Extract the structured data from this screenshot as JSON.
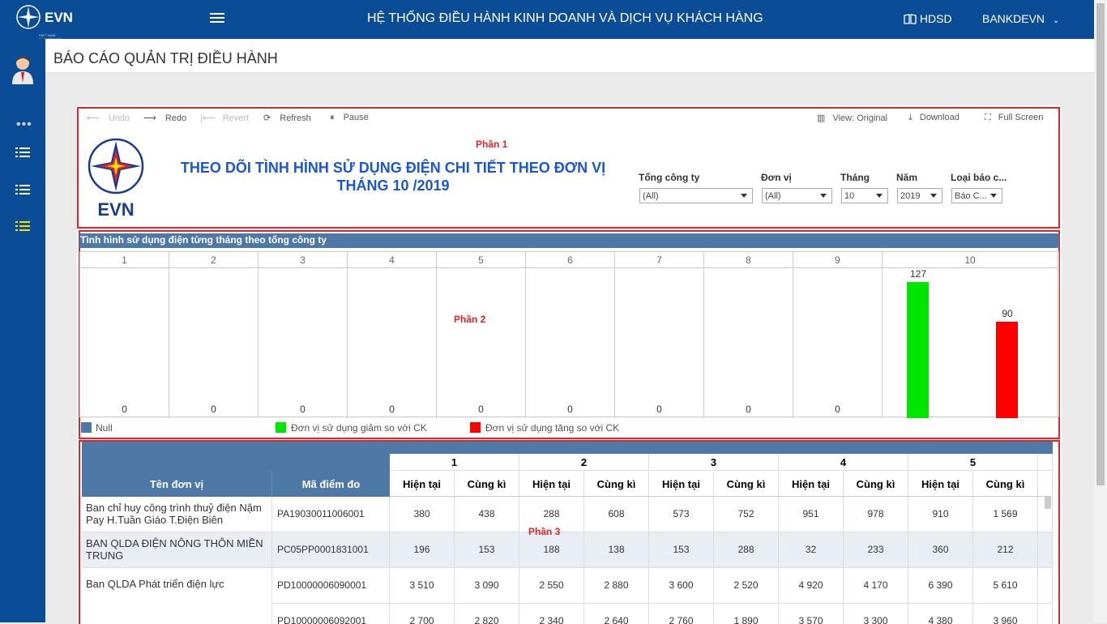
{
  "topbar": {
    "logo_text": "EVN",
    "logo_sub": "VIET NAM ELECTRICITY",
    "app_title": "HỆ THỐNG ĐIỀU HÀNH KINH DOANH VÀ DỊCH VỤ KHÁCH HÀNG",
    "help_label": "HDSD",
    "user_name": "BANKDEVN"
  },
  "page": {
    "title": "BÁO CÁO QUẢN TRỊ ĐIỀU HÀNH"
  },
  "toolbar": {
    "undo": "Undo",
    "redo": "Redo",
    "revert": "Revert",
    "refresh": "Refresh",
    "pause": "Pause",
    "view": "View: Original",
    "download": "Download",
    "fullscreen": "Full Screen"
  },
  "dashboard": {
    "logo_text": "EVN",
    "title_line1": "THEO DÕI TÌNH HÌNH SỬ DỤNG ĐIỆN CHI TIẾT THEO ĐƠN VỊ",
    "title_line2": "THÁNG 10 /2019",
    "part1": "Phần 1",
    "part2": "Phần 2",
    "part3": "Phần 3"
  },
  "filters": {
    "company": {
      "label": "Tổng công ty",
      "value": "(All)"
    },
    "unit": {
      "label": "Đơn vị",
      "value": "(All)"
    },
    "month": {
      "label": "Tháng",
      "value": "10"
    },
    "year": {
      "label": "Năm",
      "value": "2019"
    },
    "report_type": {
      "label": "Loại báo c...",
      "value": "Báo C..."
    }
  },
  "chart_section": {
    "title": "Tình hình sử dụng điện từng tháng theo tổng công ty"
  },
  "chart_data": {
    "type": "bar",
    "categories": [
      "1",
      "2",
      "3",
      "4",
      "5",
      "6",
      "7",
      "8",
      "9",
      "10"
    ],
    "series": [
      {
        "name": "Null",
        "values": [
          0,
          0,
          0,
          0,
          0,
          0,
          0,
          0,
          0,
          null
        ],
        "color": "#4e79a7"
      },
      {
        "name": "Đơn vị sử dụng giảm so với CK",
        "values": [
          null,
          null,
          null,
          null,
          null,
          null,
          null,
          null,
          null,
          127
        ],
        "color": "#00e600"
      },
      {
        "name": "Đơn vị sử dụng tăng so với CK",
        "values": [
          null,
          null,
          null,
          null,
          null,
          null,
          null,
          null,
          null,
          90
        ],
        "color": "#ff0000"
      }
    ],
    "ylim": [
      0,
      140
    ],
    "legend": "bottom"
  },
  "table": {
    "col_unit": "Tên đơn vị",
    "col_code": "Mã điểm đo",
    "months": [
      "1",
      "2",
      "3",
      "4",
      "5"
    ],
    "sub_current": "Hiện tại",
    "sub_prior": "Cùng kì",
    "rows": [
      {
        "unit": "Ban chỉ huy công trình thuỷ điện Nậm Pay H.Tuần Giáo T.Điện Biên",
        "code": "PA19030011006001",
        "values": [
          "380",
          "438",
          "288",
          "608",
          "573",
          "752",
          "951",
          "978",
          "910",
          "1 569"
        ]
      },
      {
        "unit": "BAN QLDA ĐIỆN NÔNG THÔN MIỀN TRUNG",
        "code": "PC05PP0001831001",
        "values": [
          "196",
          "153",
          "188",
          "138",
          "153",
          "288",
          "32",
          "233",
          "360",
          "212"
        ]
      },
      {
        "unit": "Ban QLDA Phát triển điện lực",
        "code": "PD10000006090001",
        "values": [
          "3 510",
          "3 090",
          "2 550",
          "2 880",
          "3 600",
          "2 520",
          "4 920",
          "4 170",
          "6 390",
          "5 610"
        ]
      },
      {
        "unit": "",
        "code": "PD10000006092001",
        "values": [
          "2 700",
          "2 820",
          "2 340",
          "2 640",
          "2 760",
          "1 890",
          "3 570",
          "3 300",
          "4 380",
          "3 960"
        ]
      }
    ]
  }
}
